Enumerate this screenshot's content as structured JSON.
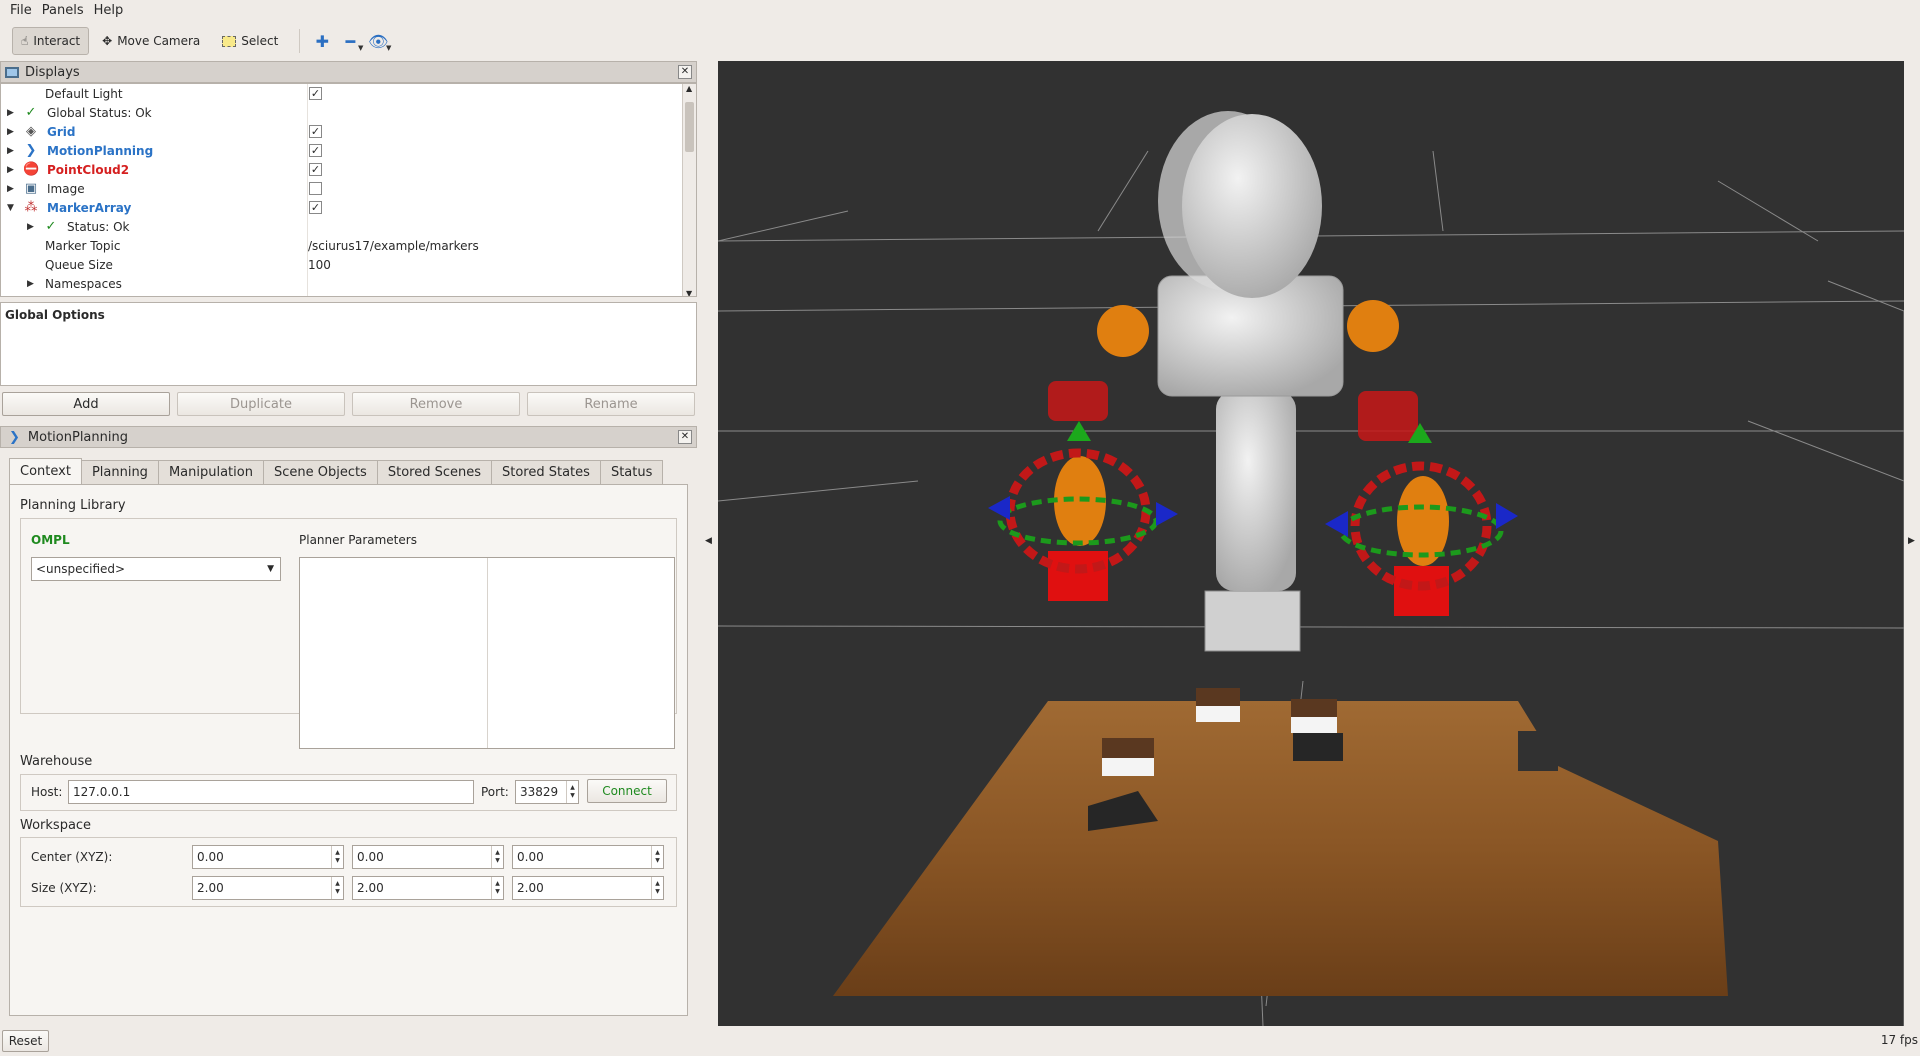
{
  "menu": {
    "items": [
      "File",
      "Panels",
      "Help"
    ]
  },
  "toolbar": {
    "interact": "Interact",
    "move_camera": "Move Camera",
    "select": "Select"
  },
  "displays": {
    "title": "Displays",
    "rows": {
      "default_light": "Default Light",
      "global_status": "Global Status: Ok",
      "grid": "Grid",
      "motion_planning": "MotionPlanning",
      "pointcloud2": "PointCloud2",
      "image": "Image",
      "marker_array": "MarkerArray",
      "status": "Status: Ok",
      "marker_topic": "Marker Topic",
      "marker_topic_value": "/sciurus17/example/markers",
      "queue_size": "Queue Size",
      "queue_size_value": "100",
      "namespaces": "Namespaces"
    },
    "checked": {
      "default_light": true,
      "grid": true,
      "motion_planning": true,
      "pointcloud2": true,
      "image": false,
      "marker_array": true
    },
    "description_title": "Global Options",
    "buttons": {
      "add": "Add",
      "duplicate": "Duplicate",
      "remove": "Remove",
      "rename": "Rename"
    }
  },
  "motion_panel": {
    "title": "MotionPlanning",
    "tabs": [
      "Context",
      "Planning",
      "Manipulation",
      "Scene Objects",
      "Stored Scenes",
      "Stored States",
      "Status"
    ],
    "active_tab": "Context",
    "planning_library": "Planning Library",
    "ompl": "OMPL",
    "planner_select": "<unspecified>",
    "planner_params": "Planner Parameters",
    "warehouse": "Warehouse",
    "host_label": "Host:",
    "host_value": "127.0.0.1",
    "port_label": "Port:",
    "port_value": "33829",
    "connect": "Connect",
    "workspace": "Workspace",
    "center_label": "Center (XYZ):",
    "center": [
      "0.00",
      "0.00",
      "0.00"
    ],
    "size_label": "Size (XYZ):",
    "size": [
      "2.00",
      "2.00",
      "2.00"
    ]
  },
  "status": {
    "reset": "Reset",
    "fps": "17 fps"
  },
  "colors": {
    "accent_blue": "#2b73c6",
    "error_red": "#d52020",
    "ompl_green": "#1f8a1f",
    "viewport_bg": "#313131"
  }
}
